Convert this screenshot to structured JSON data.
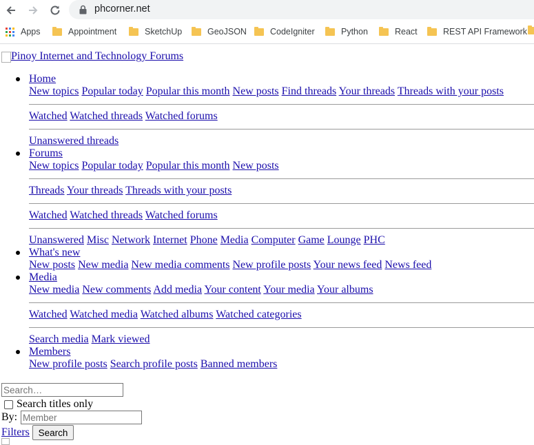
{
  "browser": {
    "url": "phcorner.net",
    "bookmarks": [
      {
        "label": "Apps",
        "icon": "apps-grid-icon"
      },
      {
        "label": "Appointment",
        "icon": "folder-icon"
      },
      {
        "label": "SketchUp",
        "icon": "folder-icon"
      },
      {
        "label": "GeoJSON",
        "icon": "folder-icon"
      },
      {
        "label": "CodeIgniter",
        "icon": "folder-icon"
      },
      {
        "label": "Python",
        "icon": "folder-icon"
      },
      {
        "label": "React",
        "icon": "folder-icon"
      },
      {
        "label": "REST API Framework",
        "icon": "folder-icon"
      }
    ]
  },
  "page": {
    "logo_alt": "Pinoy Internet and Technology Forums",
    "nav": [
      {
        "label": "Home",
        "lines": [
          [
            "New topics",
            "Popular today",
            "Popular this month",
            "New posts",
            "Find threads",
            "Your threads",
            "Threads with your posts"
          ],
          "hr",
          [
            "Watched",
            "Watched threads",
            "Watched forums"
          ],
          "hr",
          [
            "Unanswered threads"
          ]
        ]
      },
      {
        "label": "Forums",
        "lines": [
          [
            "New topics",
            "Popular today",
            "Popular this month",
            "New posts"
          ],
          "hr",
          [
            "Threads",
            "Your threads",
            "Threads with your posts"
          ],
          "hr",
          [
            "Watched",
            "Watched threads",
            "Watched forums"
          ],
          "hr",
          [
            "Unanswered",
            "Misc",
            "Network",
            "Internet",
            "Phone",
            "Media",
            "Computer",
            "Game",
            "Lounge",
            "PHC"
          ]
        ]
      },
      {
        "label": "What's new",
        "lines": [
          [
            "New posts",
            "New media",
            "New media comments",
            "New profile posts",
            "Your news feed",
            "News feed"
          ]
        ]
      },
      {
        "label": "Media",
        "lines": [
          [
            "New media",
            "New comments",
            "Add media",
            "Your content",
            "Your media",
            "Your albums"
          ],
          "hr",
          [
            "Watched",
            "Watched media",
            "Watched albums",
            "Watched categories"
          ],
          "hr",
          [
            "Search media",
            "Mark viewed"
          ]
        ]
      },
      {
        "label": "Members",
        "lines": [
          [
            "New profile posts",
            "Search profile posts",
            "Banned members"
          ]
        ]
      }
    ],
    "search": {
      "placeholder": "Search…",
      "titles_only_label": "Search titles only",
      "by_label": "By:",
      "member_placeholder": "Member",
      "filters_label": "Filters",
      "search_button": "Search"
    }
  },
  "colors": {
    "link": "#1a0dab",
    "omnibox_bg": "#f1f3f4",
    "folder": "#f5c453"
  }
}
